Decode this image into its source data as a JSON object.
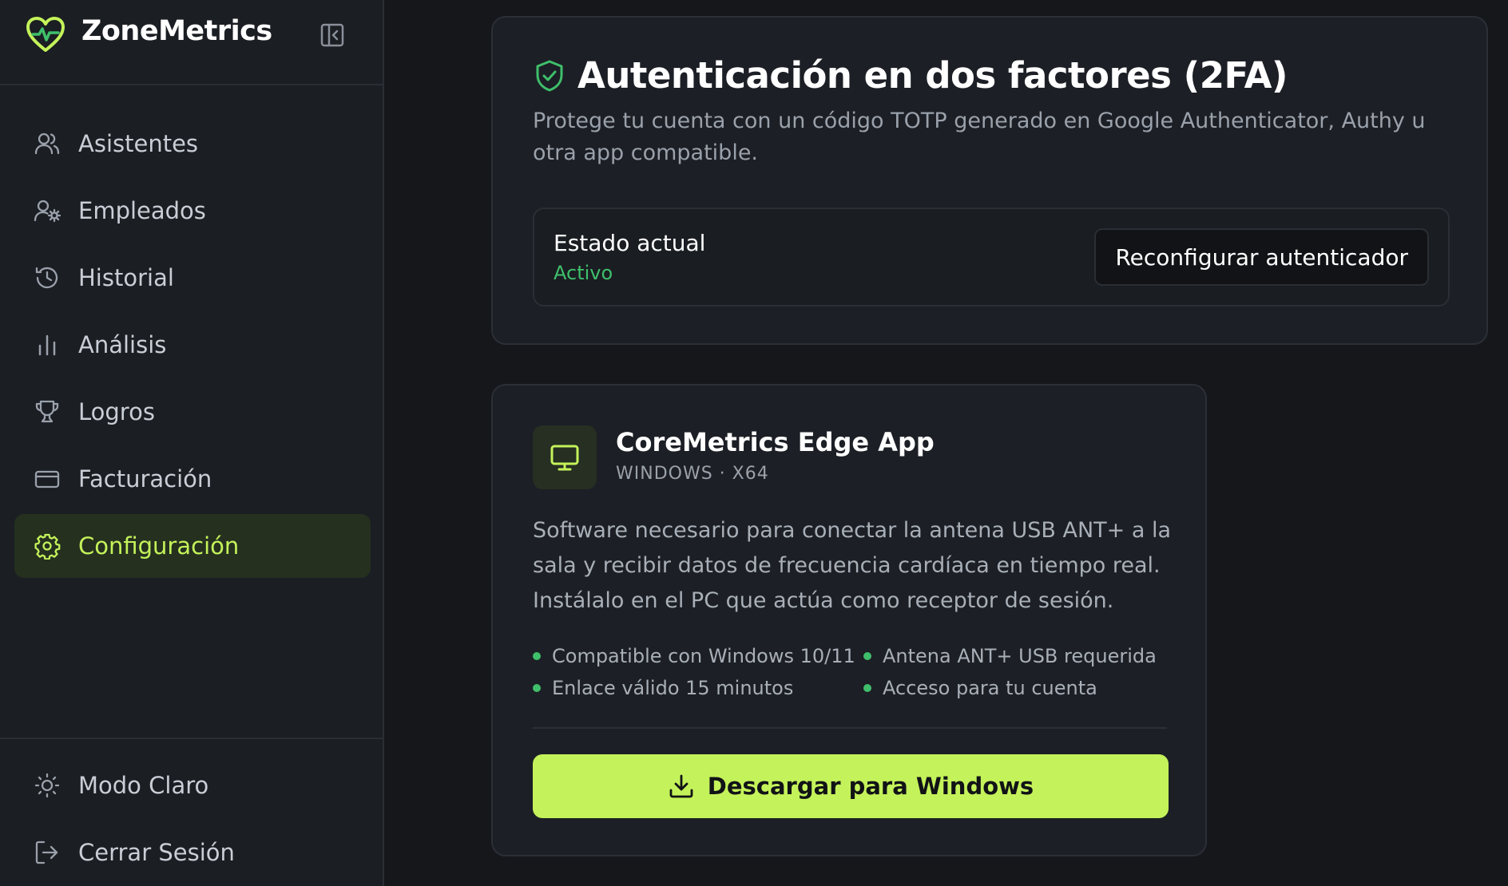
{
  "app": {
    "brand": "ZoneMetrics",
    "accent": "#c4f25a",
    "success": "#3fbf6b"
  },
  "sidebar": {
    "items": [
      {
        "label": "Asistentes",
        "icon": "users-icon"
      },
      {
        "label": "Empleados",
        "icon": "user-cog-icon"
      },
      {
        "label": "Historial",
        "icon": "history-icon"
      },
      {
        "label": "Análisis",
        "icon": "bar-chart-icon"
      },
      {
        "label": "Logros",
        "icon": "trophy-icon"
      },
      {
        "label": "Facturación",
        "icon": "credit-card-icon"
      },
      {
        "label": "Configuración",
        "icon": "gear-icon",
        "active": true
      }
    ],
    "bottom": [
      {
        "label": "Modo Claro",
        "icon": "sun-icon"
      },
      {
        "label": "Cerrar Sesión",
        "icon": "logout-icon"
      }
    ]
  },
  "twofa": {
    "title": "Autenticación en dos factores (2FA)",
    "description": "Protege tu cuenta con un código TOTP generado en Google Authenticator, Authy u otra app compatible.",
    "status_label": "Estado actual",
    "status_value": "Activo",
    "button_label": "Reconfigurar autenticador"
  },
  "edge_app": {
    "name": "CoreMetrics Edge App",
    "platform": "WINDOWS · X64",
    "description": "Software necesario para conectar la antena USB ANT+ a la sala y recibir datos de frecuencia cardíaca en tiempo real. Instálalo en el PC que actúa como receptor de sesión.",
    "features": [
      "Compatible con Windows 10/11",
      "Antena ANT+ USB requerida",
      "Enlace válido 15 minutos",
      "Acceso para tu cuenta"
    ],
    "download_label": "Descargar para Windows"
  }
}
